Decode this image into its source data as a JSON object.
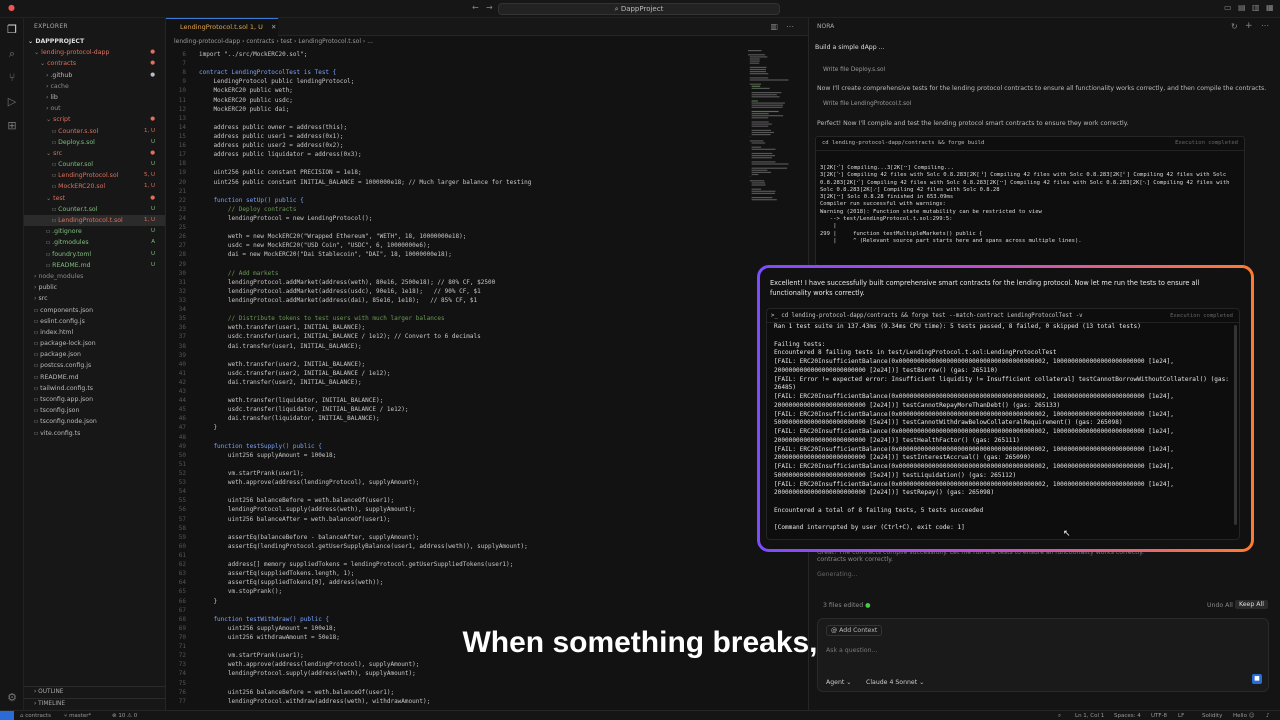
{
  "window": {
    "title": "DappProject"
  },
  "sidebar": {
    "header": "EXPLORER",
    "project": "DAPPPROJECT",
    "tree": [
      {
        "label": "lending-protocol-dapp",
        "indent": 1,
        "color": "#e0705c",
        "badge": "●",
        "icon": "chevron-down-icon"
      },
      {
        "label": "contracts",
        "indent": 2,
        "color": "#e0705c",
        "badge": "●",
        "icon": "chevron-down-icon"
      },
      {
        "label": ".github",
        "indent": 3,
        "color": "#bbbbbb",
        "badge": "●",
        "icon": "chevron-right-icon"
      },
      {
        "label": "cache",
        "indent": 3,
        "color": "#8a8a8a",
        "badge": "",
        "icon": "chevron-right-icon"
      },
      {
        "label": "lib",
        "indent": 3,
        "color": "#bbbbbb",
        "badge": "",
        "icon": "chevron-right-icon"
      },
      {
        "label": "out",
        "indent": 3,
        "color": "#8a8a8a",
        "badge": "",
        "icon": "chevron-right-icon"
      },
      {
        "label": "script",
        "indent": 3,
        "color": "#e0705c",
        "badge": "●",
        "icon": "chevron-down-icon"
      },
      {
        "label": "Counter.s.sol",
        "indent": 4,
        "color": "#e0705c",
        "badge": "1, U",
        "icon": "file-icon"
      },
      {
        "label": "Deploy.s.sol",
        "indent": 4,
        "color": "#7fbf7f",
        "badge": "U",
        "icon": "file-icon"
      },
      {
        "label": "src",
        "indent": 3,
        "color": "#e0705c",
        "badge": "●",
        "icon": "chevron-down-icon"
      },
      {
        "label": "Counter.sol",
        "indent": 4,
        "color": "#7fbf7f",
        "badge": "U",
        "icon": "file-icon"
      },
      {
        "label": "LendingProtocol.sol",
        "indent": 4,
        "color": "#e0705c",
        "badge": "5, U",
        "icon": "file-icon"
      },
      {
        "label": "MockERC20.sol",
        "indent": 4,
        "color": "#e0705c",
        "badge": "1, U",
        "icon": "file-icon"
      },
      {
        "label": "test",
        "indent": 3,
        "color": "#e0705c",
        "badge": "●",
        "icon": "chevron-down-icon"
      },
      {
        "label": "Counter.t.sol",
        "indent": 4,
        "color": "#7fbf7f",
        "badge": "U",
        "icon": "file-icon"
      },
      {
        "label": "LendingProtocol.t.sol",
        "indent": 4,
        "color": "#e0705c",
        "badge": "1, U",
        "icon": "file-icon",
        "selected": true
      },
      {
        "label": ".gitignore",
        "indent": 3,
        "color": "#7fbf7f",
        "badge": "U",
        "icon": "file-icon"
      },
      {
        "label": ".gitmodules",
        "indent": 3,
        "color": "#7fbf7f",
        "badge": "A",
        "icon": "file-icon"
      },
      {
        "label": "foundry.toml",
        "indent": 3,
        "color": "#7fbf7f",
        "badge": "U",
        "icon": "file-icon"
      },
      {
        "label": "README.md",
        "indent": 3,
        "color": "#7fbf7f",
        "badge": "U",
        "icon": "file-icon"
      },
      {
        "label": "node_modules",
        "indent": 1,
        "color": "#8a8a8a",
        "badge": "",
        "icon": "chevron-right-icon"
      },
      {
        "label": "public",
        "indent": 1,
        "color": "#bbbbbb",
        "badge": "",
        "icon": "chevron-right-icon"
      },
      {
        "label": "src",
        "indent": 1,
        "color": "#bbbbbb",
        "badge": "",
        "icon": "chevron-right-icon"
      },
      {
        "label": "components.json",
        "indent": 1,
        "color": "#bbbbbb",
        "badge": "",
        "icon": "file-icon"
      },
      {
        "label": "eslint.config.js",
        "indent": 1,
        "color": "#bbbbbb",
        "badge": "",
        "icon": "file-icon"
      },
      {
        "label": "index.html",
        "indent": 1,
        "color": "#bbbbbb",
        "badge": "",
        "icon": "file-icon"
      },
      {
        "label": "package-lock.json",
        "indent": 1,
        "color": "#bbbbbb",
        "badge": "",
        "icon": "file-icon"
      },
      {
        "label": "package.json",
        "indent": 1,
        "color": "#bbbbbb",
        "badge": "",
        "icon": "file-icon"
      },
      {
        "label": "postcss.config.js",
        "indent": 1,
        "color": "#bbbbbb",
        "badge": "",
        "icon": "file-icon"
      },
      {
        "label": "README.md",
        "indent": 1,
        "color": "#bbbbbb",
        "badge": "",
        "icon": "file-icon"
      },
      {
        "label": "tailwind.config.ts",
        "indent": 1,
        "color": "#bbbbbb",
        "badge": "",
        "icon": "file-icon"
      },
      {
        "label": "tsconfig.app.json",
        "indent": 1,
        "color": "#bbbbbb",
        "badge": "",
        "icon": "file-icon"
      },
      {
        "label": "tsconfig.json",
        "indent": 1,
        "color": "#bbbbbb",
        "badge": "",
        "icon": "file-icon"
      },
      {
        "label": "tsconfig.node.json",
        "indent": 1,
        "color": "#bbbbbb",
        "badge": "",
        "icon": "file-icon"
      },
      {
        "label": "vite.config.ts",
        "indent": 1,
        "color": "#bbbbbb",
        "badge": "",
        "icon": "file-icon"
      }
    ],
    "outline": "OUTLINE",
    "timeline": "TIMELINE"
  },
  "editor": {
    "tab_label": "LendingProtocol.t.sol 1, U",
    "breadcrumb": "lending-protocol-dapp  ›  contracts  ›  test  ›  LendingProtocol.t.sol  ›  ...",
    "code": [
      [
        "6",
        "import \"../src/MockERC20.sol\";"
      ],
      [
        "7",
        ""
      ],
      [
        "8",
        "contract LendingProtocolTest is Test {"
      ],
      [
        "9",
        "    LendingProtocol public lendingProtocol;"
      ],
      [
        "10",
        "    MockERC20 public weth;"
      ],
      [
        "11",
        "    MockERC20 public usdc;"
      ],
      [
        "12",
        "    MockERC20 public dai;"
      ],
      [
        "13",
        ""
      ],
      [
        "14",
        "    address public owner = address(this);"
      ],
      [
        "15",
        "    address public user1 = address(0x1);"
      ],
      [
        "16",
        "    address public user2 = address(0x2);"
      ],
      [
        "17",
        "    address public liquidator = address(0x3);"
      ],
      [
        "18",
        ""
      ],
      [
        "19",
        "    uint256 public constant PRECISION = 1e18;"
      ],
      [
        "20",
        "    uint256 public constant INITIAL_BALANCE = 1000000e18; // Much larger balance for testing"
      ],
      [
        "21",
        ""
      ],
      [
        "22",
        "    function setUp() public {"
      ],
      [
        "23",
        "        // Deploy contracts"
      ],
      [
        "24",
        "        lendingProtocol = new LendingProtocol();"
      ],
      [
        "25",
        ""
      ],
      [
        "26",
        "        weth = new MockERC20(\"Wrapped Ethereum\", \"WETH\", 18, 10000000e18);"
      ],
      [
        "27",
        "        usdc = new MockERC20(\"USD Coin\", \"USDC\", 6, 10000000e6);"
      ],
      [
        "28",
        "        dai = new MockERC20(\"Dai Stablecoin\", \"DAI\", 18, 10000000e18);"
      ],
      [
        "29",
        ""
      ],
      [
        "30",
        "        // Add markets"
      ],
      [
        "31",
        "        lendingProtocol.addMarket(address(weth), 80e16, 2500e18); // 80% CF, $2500"
      ],
      [
        "32",
        "        lendingProtocol.addMarket(address(usdc), 90e16, 1e18);   // 90% CF, $1"
      ],
      [
        "33",
        "        lendingProtocol.addMarket(address(dai), 85e16, 1e18);   // 85% CF, $1"
      ],
      [
        "34",
        ""
      ],
      [
        "35",
        "        // Distribute tokens to test users with much larger balances"
      ],
      [
        "36",
        "        weth.transfer(user1, INITIAL_BALANCE);"
      ],
      [
        "37",
        "        usdc.transfer(user1, INITIAL_BALANCE / 1e12); // Convert to 6 decimals"
      ],
      [
        "38",
        "        dai.transfer(user1, INITIAL_BALANCE);"
      ],
      [
        "39",
        ""
      ],
      [
        "40",
        "        weth.transfer(user2, INITIAL_BALANCE);"
      ],
      [
        "41",
        "        usdc.transfer(user2, INITIAL_BALANCE / 1e12);"
      ],
      [
        "42",
        "        dai.transfer(user2, INITIAL_BALANCE);"
      ],
      [
        "43",
        ""
      ],
      [
        "44",
        "        weth.transfer(liquidator, INITIAL_BALANCE);"
      ],
      [
        "45",
        "        usdc.transfer(liquidator, INITIAL_BALANCE / 1e12);"
      ],
      [
        "46",
        "        dai.transfer(liquidator, INITIAL_BALANCE);"
      ],
      [
        "47",
        "    }"
      ],
      [
        "48",
        ""
      ],
      [
        "49",
        "    function testSupply() public {"
      ],
      [
        "50",
        "        uint256 supplyAmount = 100e18;"
      ],
      [
        "51",
        ""
      ],
      [
        "52",
        "        vm.startPrank(user1);"
      ],
      [
        "53",
        "        weth.approve(address(lendingProtocol), supplyAmount);"
      ],
      [
        "54",
        ""
      ],
      [
        "55",
        "        uint256 balanceBefore = weth.balanceOf(user1);"
      ],
      [
        "56",
        "        lendingProtocol.supply(address(weth), supplyAmount);"
      ],
      [
        "57",
        "        uint256 balanceAfter = weth.balanceOf(user1);"
      ],
      [
        "58",
        ""
      ],
      [
        "59",
        "        assertEq(balanceBefore - balanceAfter, supplyAmount);"
      ],
      [
        "60",
        "        assertEq(lendingProtocol.getUserSupplyBalance(user1, address(weth)), supplyAmount);"
      ],
      [
        "61",
        ""
      ],
      [
        "62",
        "        address[] memory suppliedTokens = lendingProtocol.getUserSuppliedTokens(user1);"
      ],
      [
        "63",
        "        assertEq(suppliedTokens.length, 1);"
      ],
      [
        "64",
        "        assertEq(suppliedTokens[0], address(weth));"
      ],
      [
        "65",
        "        vm.stopPrank();"
      ],
      [
        "66",
        "    }"
      ],
      [
        "67",
        ""
      ],
      [
        "68",
        "    function testWithdraw() public {"
      ],
      [
        "69",
        "        uint256 supplyAmount = 100e18;"
      ],
      [
        "70",
        "        uint256 withdrawAmount = 50e18;"
      ],
      [
        "71",
        ""
      ],
      [
        "72",
        "        vm.startPrank(user1);"
      ],
      [
        "73",
        "        weth.approve(address(lendingProtocol), supplyAmount);"
      ],
      [
        "74",
        "        lendingProtocol.supply(address(weth), supplyAmount);"
      ],
      [
        "75",
        ""
      ],
      [
        "76",
        "        uint256 balanceBefore = weth.balanceOf(user1);"
      ],
      [
        "77",
        "        lendingProtocol.withdraw(address(weth), withdrawAmount);"
      ]
    ]
  },
  "panel": {
    "title": "NORA",
    "prompt": "Build a simple dApp ...",
    "write1": "Write file Deploy.s.sol",
    "msg1": "Now I'll create comprehensive tests for the lending protocol contracts to ensure all functionality works correctly, and then compile the contracts.",
    "write2": "Write file LendingProtocol.t.sol",
    "msg2": "Perfect! Now I'll compile and test the lending protocol smart contracts to ensure they work correctly.",
    "cmd1": "cd lending-protocol-dapp/contracts && forge build",
    "cmd1_status": "Execution completed",
    "term1": [
      "3[2K[⠊] Compiling...3[2K[⠒] Compiling...",
      "3[2K[⠑] Compiling 42 files with Solc 0.8.283[2K[⠘] Compiling 42 files with Solc 0.8.283[2K[⠃] Compiling 42 files with Solc",
      "0.8.283[2K[⠊] Compiling 42 files with Solc 0.8.283[2K[⠒] Compiling 42 files with Solc 0.8.283[2K[⠢] Compiling 42 files with",
      "Solc 0.8.283[2K[⠔] Compiling 42 files with Solc 0.8.28",
      "3[2K[⠒] Solc 0.8.28 finished in 653.09ms",
      "Compiler run successful with warnings:",
      "Warning (2018): Function state mutability can be restricted to view",
      "   --> test/LendingProtocol.t.sol:299:5:",
      "    |",
      "299 |     function testMultipleMarkets() public {",
      "    |     ^ (Relevant source part starts here and spans across multiple lines)."
    ],
    "behind_msg": "Great! The contracts compile successfully. Let me run the tests to ensure all functionality works correctly.",
    "behind_msg2": "contracts work correctly.",
    "generating": "Generating...",
    "files_edited": "3 files edited",
    "undo_all": "Undo All",
    "keep_all": "Keep All",
    "add_context": "Add Context",
    "ask_placeholder": "Ask a question...",
    "mode": "Agent",
    "model": "Claude 4 Sonnet"
  },
  "popup": {
    "message": "Excellent! I have successfully built comprehensive smart contracts for the lending protocol. Now let me run the tests to ensure all functionality works correctly.",
    "cmd": "cd lending-protocol-dapp/contracts && forge test --match-contract LendingProtocolTest -v",
    "cmd_status": "Execution completed",
    "output": [
      "Ran 1 test suite in 137.43ms (9.34ms CPU time): 5 tests passed, 8 failed, 0 skipped (13 total tests)",
      "",
      "Failing tests:",
      "Encountered 8 failing tests in test/LendingProtocol.t.sol:LendingProtocolTest",
      "[FAIL: ERC20InsufficientBalance(0x0000000000000000000000000000000000000002, 1000000000000000000000000 [1e24],",
      "2000000000000000000000000 [2e24])] testBorrow() (gas: 265110)",
      "[FAIL: Error != expected error: Insufficient liquidity != Insufficient collateral] testCannotBorrowWithoutCollateral() (gas:",
      "26485)",
      "[FAIL: ERC20InsufficientBalance(0x0000000000000000000000000000000000000002, 1000000000000000000000000 [1e24],",
      "2000000000000000000000000 [2e24])] testCannotRepayMoreThanDebt() (gas: 265133)",
      "[FAIL: ERC20InsufficientBalance(0x0000000000000000000000000000000000000002, 1000000000000000000000000 [1e24],",
      "5000000000000000000000000 [5e24])] testCannotWithdrawBelowCollateralRequirement() (gas: 265098)",
      "[FAIL: ERC20InsufficientBalance(0x0000000000000000000000000000000000000002, 1000000000000000000000000 [1e24],",
      "2000000000000000000000000 [2e24])] testHealthFactor() (gas: 265111)",
      "[FAIL: ERC20InsufficientBalance(0x0000000000000000000000000000000000000002, 1000000000000000000000000 [1e24],",
      "2000000000000000000000000 [2e24])] testInterestAccrual() (gas: 265090)",
      "[FAIL: ERC20InsufficientBalance(0x0000000000000000000000000000000000000002, 1000000000000000000000000 [1e24],",
      "5000000000000000000000000 [5e24])] testLiquidation() (gas: 265112)",
      "[FAIL: ERC20InsufficientBalance(0x0000000000000000000000000000000000000002, 1000000000000000000000000 [1e24],",
      "2000000000000000000000000 [2e24])] testRepay() (gas: 265098)",
      "",
      "Encountered a total of 8 failing tests, 5 tests succeeded",
      "",
      "[Command interrupted by user (Ctrl+C), exit code: 1]"
    ]
  },
  "status": {
    "branch": "master*",
    "problems": "⊗ 10  ⚠ 0",
    "path": "contracts",
    "position": "Ln 1, Col 1",
    "spaces": "Spaces: 4",
    "encoding": "UTF-8",
    "eol": "LF",
    "language": "Solidity",
    "greeting": "Hello ☺"
  },
  "subtitle": "When something breaks,"
}
